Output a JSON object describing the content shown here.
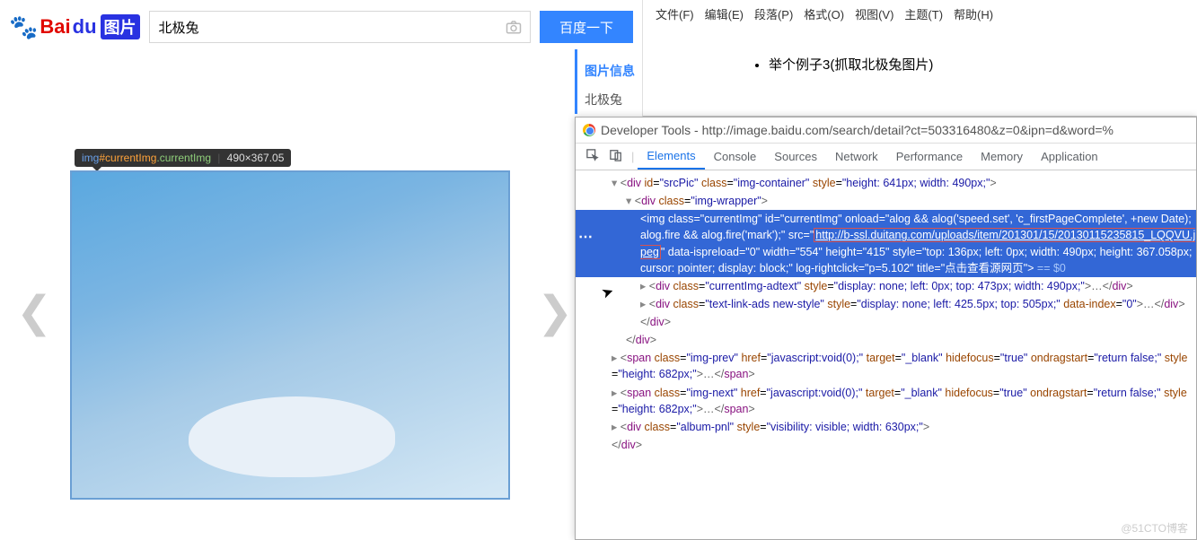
{
  "baidu": {
    "logo": {
      "bai": "Bai",
      "du": "du",
      "tupian": "图片"
    },
    "search_value": "北极兔",
    "search_btn": "百度一下",
    "sidebar": {
      "info": "图片信息",
      "keyword": "北极兔"
    },
    "tooltip": {
      "t1": "img",
      "t2": "#currentImg",
      "t3": ".currentImg",
      "dims": "490×367.05"
    }
  },
  "typora": {
    "menu": [
      "文件(F)",
      "编辑(E)",
      "段落(P)",
      "格式(O)",
      "视图(V)",
      "主题(T)",
      "帮助(H)"
    ],
    "bullet": "举个例子3(抓取北极兔图片)"
  },
  "devtools": {
    "title": "Developer Tools - http://image.baidu.com/search/detail?ct=503316480&z=0&ipn=d&word=%",
    "tabs": [
      "Elements",
      "Console",
      "Sources",
      "Network",
      "Performance",
      "Memory",
      "Application"
    ],
    "code": {
      "l1a": "<div id=\"srcPic\" class=\"img-container\" style=\"height: 641px; width: 490px;\">",
      "l2": "<div class=\"img-wrapper\">",
      "sel_img_open": "<img class=\"currentImg\" id=\"currentImg\" onload=\"alog && alog('speed.set', 'c_firstPageComplete', +new Date); alog.fire && alog.fire('mark');\" src=\"",
      "sel_url": "http://b-ssl.duitang.com/uploads/item/201301/15/20130115235815_LQQVU.jpeg",
      "sel_rest": "\" data-ispreload=\"0\" width=\"554\" height=\"415\" style=\"top: 136px; left: 0px; width: 490px; height: 367.058px; cursor: pointer; display: block;\" log-rightclick=\"p=5.102\" title=\"点击查看源网页\"> ",
      "eq": "== $0",
      "l4": "<div class=\"currentImg-adtext\" style=\"display: none; left: 0px; top: 473px; width: 490px;\">…</div>",
      "l5": "<div class=\"text-link-ads new-style\" style=\"display: none; left: 425.5px; top: 505px;\" data-index=\"0\">…</div>",
      "l6": "</div>",
      "l7": "</div>",
      "l8": "<span class=\"img-prev\" href=\"javascript:void(0);\" target=\"_blank\" hidefocus=\"true\" ondragstart=\"return false;\" style=\"height: 682px;\">…</span>",
      "l9": "<span class=\"img-next\" href=\"javascript:void(0);\" target=\"_blank\" hidefocus=\"true\" ondragstart=\"return false;\" style=\"height: 682px;\">…</span>",
      "l10": "<div class=\"album-pnl\" style=\"visibility: visible; width: 630px;\">",
      "l11": "</div>"
    }
  },
  "watermark": "@51CTO博客"
}
